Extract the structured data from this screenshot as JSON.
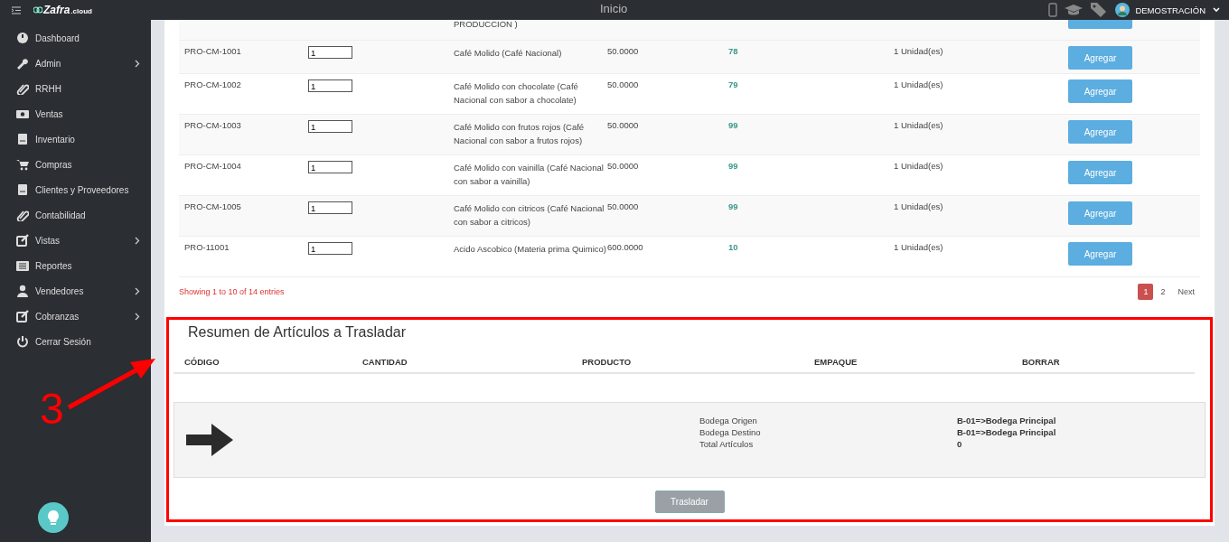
{
  "header": {
    "logo": {
      "name": "Zafra",
      "suffix": ".cloud"
    },
    "title": "Inicio",
    "user": "DEMOSTRACIÓN"
  },
  "sidebar": {
    "items": [
      {
        "label": "Dashboard",
        "expandable": false
      },
      {
        "label": "Admin",
        "expandable": true
      },
      {
        "label": "RRHH",
        "expandable": false
      },
      {
        "label": "Ventas",
        "expandable": false
      },
      {
        "label": "Inventario",
        "expandable": false
      },
      {
        "label": "Compras",
        "expandable": false
      },
      {
        "label": "Clientes y Proveedores",
        "expandable": false
      },
      {
        "label": "Contabilidad",
        "expandable": false
      },
      {
        "label": "Vistas",
        "expandable": true
      },
      {
        "label": "Reportes",
        "expandable": false
      },
      {
        "label": "Vendedores",
        "expandable": true
      },
      {
        "label": "Cobranzas",
        "expandable": true
      },
      {
        "label": "Cerrar Sesión",
        "expandable": false
      }
    ]
  },
  "products": {
    "partial_row": {
      "product": "PRODUCCION )"
    },
    "rows": [
      {
        "code": "PRO-CM-1001",
        "quantity": "1",
        "product": "Café Molido (Café Nacional)",
        "price": "50.0000",
        "stock": "78",
        "unit": "1 Unidad(es)",
        "action": "Agregar"
      },
      {
        "code": "PRO-CM-1002",
        "quantity": "1",
        "product": "Café Molido con chocolate (Café Nacional con sabor a chocolate)",
        "price": "50.0000",
        "stock": "79",
        "unit": "1 Unidad(es)",
        "action": "Agregar"
      },
      {
        "code": "PRO-CM-1003",
        "quantity": "1",
        "product": "Café Molido con frutos rojos (Café Nacional con sabor a frutos rojos)",
        "price": "50.0000",
        "stock": "99",
        "unit": "1 Unidad(es)",
        "action": "Agregar"
      },
      {
        "code": "PRO-CM-1004",
        "quantity": "1",
        "product": "Café Molido con vainilla (Café Nacional con sabor a vainilla)",
        "price": "50.0000",
        "stock": "99",
        "unit": "1 Unidad(es)",
        "action": "Agregar"
      },
      {
        "code": "PRO-CM-1005",
        "quantity": "1",
        "product": "Café Molido con citricos (Café Nacional con sabor a citricos)",
        "price": "50.0000",
        "stock": "99",
        "unit": "1 Unidad(es)",
        "action": "Agregar"
      },
      {
        "code": "PRO-11001",
        "quantity": "1",
        "product": "Acido Ascobico (Materia prima Quimico)",
        "price": "600.0000",
        "stock": "10",
        "unit": "1 Unidad(es)",
        "action": "Agregar"
      }
    ],
    "info": "Showing 1 to 10 of 14 entries",
    "pages": [
      {
        "label": "1",
        "selected": true
      },
      {
        "label": "2",
        "selected": false
      },
      {
        "label": "Next",
        "selected": false
      }
    ]
  },
  "summary": {
    "title": "Resumen de Artículos a Trasladar",
    "columns": [
      "CÓDIGO",
      "CANTIDAD",
      "PRODUCTO",
      "EMPAQUE",
      "BORRAR"
    ],
    "details": [
      {
        "label": "Bodega Origen",
        "value": "B-01=>Bodega Principal"
      },
      {
        "label": "Bodega Destino",
        "value": "B-01=>Bodega Principal"
      },
      {
        "label": "Total Artículos",
        "value": "0"
      }
    ],
    "button": {
      "label": "Trasladar",
      "disabled": true
    }
  },
  "annotation": {
    "label": "3"
  }
}
